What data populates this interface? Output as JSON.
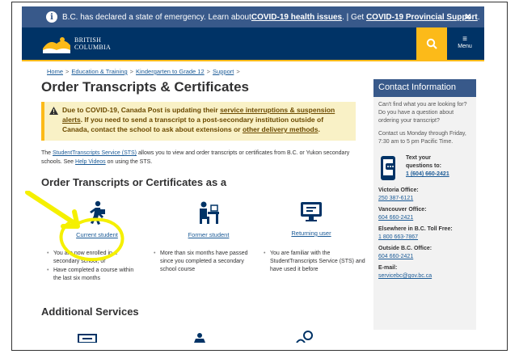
{
  "alert_bar": {
    "text_prefix": "B.C. has declared a state of emergency. Learn about ",
    "link1": "COVID-19 health issues",
    "text_mid": ". | Get ",
    "link2": "COVID-19 Provincial Support",
    "text_suffix": ".",
    "close": "×"
  },
  "header": {
    "logo_line1": "BRITISH",
    "logo_line2": "COLUMBIA",
    "menu_label": "Menu",
    "menu_bars": "≡"
  },
  "breadcrumb": {
    "items": [
      "Home",
      "Education & Training",
      "Kindergarten to Grade 12",
      "Support"
    ],
    "separator": ">"
  },
  "page_title": "Order Transcripts & Certificates",
  "covid_notice": {
    "text1": "Due to COVID-19, Canada Post is updating their ",
    "link1": "service interruptions & suspension alerts",
    "text2": ". If you need to send a transcript to a post-secondary institution outside of Canada, contact the school to ask about extensions or ",
    "link2": "other delivery methods",
    "text3": "."
  },
  "intro": {
    "text1": "The ",
    "link1": "StudentTranscripts Service (STS)",
    "text2": " allows you to view and order transcripts or certificates from B.C. or Yukon secondary schools. See ",
    "link2": "Help Videos",
    "text3": " on using the STS."
  },
  "order_section": {
    "title": "Order Transcripts or Certificates as a",
    "options": [
      {
        "label": "Current student",
        "bullets": [
          "You are now enrolled in a secondary school, or",
          "Have completed a course within the last six months"
        ]
      },
      {
        "label": "Former student",
        "bullets": [
          "More than six months have passed since you completed a secondary school course"
        ]
      },
      {
        "label": "Returning user",
        "bullets": [
          "You are familiar with the StudentTranscripts Service (STS) and have used it before"
        ]
      }
    ]
  },
  "additional_title": "Additional Services",
  "sidebar": {
    "title": "Contact Information",
    "para1": "Can't find what you are looking for? Do you have a question about ordering your transcript?",
    "para2": "Contact us Monday through Friday, 7:30 am to 5 pm Pacific Time.",
    "text_us_line1": "Text your",
    "text_us_line2": "questions to:",
    "text_us_number": "1 (604) 660-2421",
    "offices": [
      {
        "label": "Victoria Office:",
        "value": "250 387-6121"
      },
      {
        "label": "Vancouver Office:",
        "value": "604 660-2421"
      },
      {
        "label": "Elsewhere in B.C. Toll Free:",
        "value": "1 800 663-7867"
      },
      {
        "label": "Outside B.C. Office:",
        "value": "604 660-2421"
      },
      {
        "label": "E-mail:",
        "value": "servicebc@gov.bc.ca"
      }
    ]
  },
  "colors": {
    "bc_blue": "#003366",
    "bc_gold": "#fcba19",
    "link_blue": "#1a5a96",
    "sidebar_header": "#38598a",
    "annotation": "#f5f000"
  }
}
